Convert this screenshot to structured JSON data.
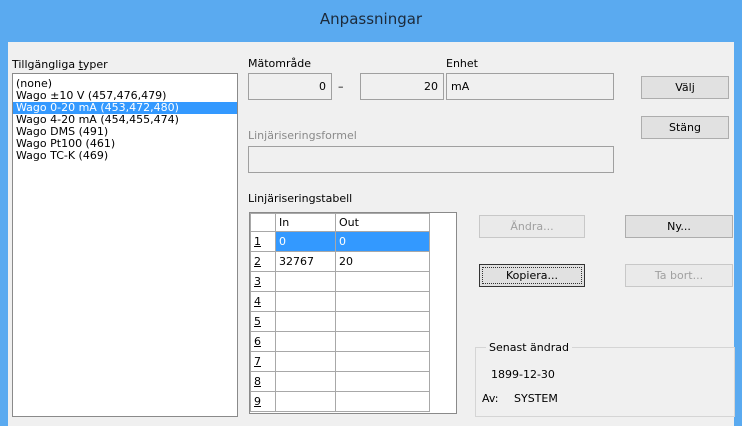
{
  "window": {
    "title": "Anpassningar"
  },
  "types": {
    "label_prefix": "Tillgängliga ",
    "label_access": "t",
    "label_suffix": "yper",
    "items": [
      {
        "label": "(none)",
        "selected": false
      },
      {
        "label": "Wago ±10 V (457,476,479)",
        "selected": false
      },
      {
        "label": "Wago 0-20 mA (453,472,480)",
        "selected": true
      },
      {
        "label": "Wago 4-20 mA (454,455,474)",
        "selected": false
      },
      {
        "label": "Wago DMS (491)",
        "selected": false
      },
      {
        "label": "Wago Pt100 (461)",
        "selected": false
      },
      {
        "label": "Wago TC-K (469)",
        "selected": false
      }
    ]
  },
  "range": {
    "label": "Mätområde",
    "min": "0",
    "separator": "–",
    "max": "20"
  },
  "unit": {
    "label": "Enhet",
    "value": "mA"
  },
  "formula": {
    "label": "Linjäriseringsformel",
    "value": ""
  },
  "table": {
    "label": "Linjäriseringstabell",
    "headers": [
      "In",
      "Out"
    ],
    "rows": [
      {
        "num": "1",
        "in": "0",
        "out": "0"
      },
      {
        "num": "2",
        "in": "32767",
        "out": "20"
      },
      {
        "num": "3",
        "in": "",
        "out": ""
      },
      {
        "num": "4",
        "in": "",
        "out": ""
      },
      {
        "num": "5",
        "in": "",
        "out": ""
      },
      {
        "num": "6",
        "in": "",
        "out": ""
      },
      {
        "num": "7",
        "in": "",
        "out": ""
      },
      {
        "num": "8",
        "in": "",
        "out": ""
      },
      {
        "num": "9",
        "in": "",
        "out": ""
      }
    ]
  },
  "buttons": {
    "valj": "Välj",
    "stang": "Stäng",
    "andra": "Ändra...",
    "ny": "Ny...",
    "kopiera": "Kopiera...",
    "ta_bort": "Ta bort..."
  },
  "last_changed": {
    "legend": "Senast ändrad",
    "date": "1899-12-30",
    "by_label": "Av:",
    "by_value": "SYSTEM"
  },
  "icons": {
    "scroll_up": "scroll-up-icon",
    "scroll_down": "scroll-down-icon"
  }
}
